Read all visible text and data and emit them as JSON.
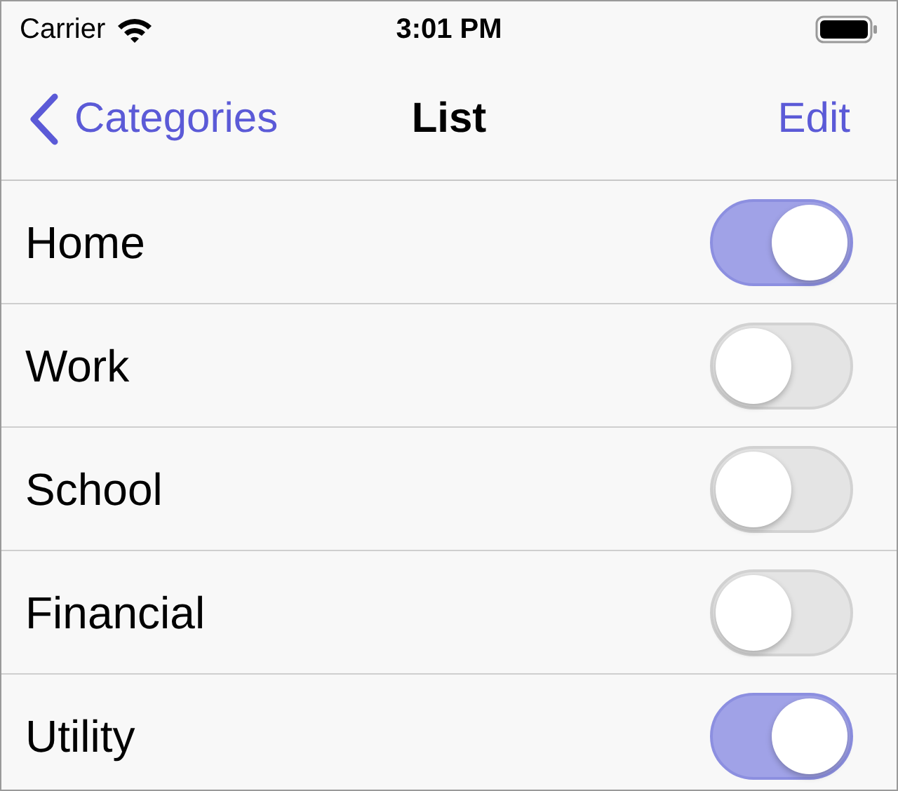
{
  "status_bar": {
    "carrier": "Carrier",
    "time": "3:01 PM"
  },
  "nav_bar": {
    "back": "Categories",
    "title": "List",
    "action": "Edit"
  },
  "rows": [
    {
      "label": "Home",
      "on": true
    },
    {
      "label": "Work",
      "on": false
    },
    {
      "label": "School",
      "on": false
    },
    {
      "label": "Financial",
      "on": false
    },
    {
      "label": "Utility",
      "on": true
    }
  ]
}
